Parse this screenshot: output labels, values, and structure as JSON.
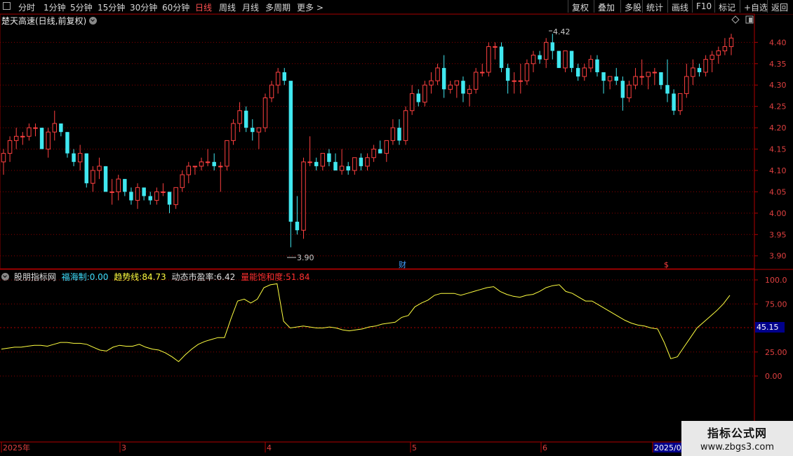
{
  "toolbar": {
    "left_items": [
      "分时",
      "1分钟",
      "5分钟",
      "15分钟",
      "30分钟",
      "60分钟",
      "日线",
      "周线",
      "月线",
      "多周期",
      "更多 >"
    ],
    "active_item": "日线",
    "right_items": [
      "复权",
      "叠加",
      "多股",
      "统计",
      "画线",
      "F10",
      "标记",
      "+自选",
      "返回"
    ]
  },
  "main_pane": {
    "title": "楚天高速(日线,前复权)",
    "price_axis": [
      "4.40",
      "4.35",
      "4.30",
      "4.25",
      "4.20",
      "4.15",
      "4.10",
      "4.05",
      "4.00",
      "3.95",
      "3.90"
    ],
    "high_label": "4.42",
    "low_label": "3.90",
    "event_marker_cai": "财",
    "event_marker_s": "$"
  },
  "indicator_pane": {
    "name": "股朋指标网",
    "items": [
      {
        "label": "福海制:",
        "value": "0.00",
        "color": "#40e0ff"
      },
      {
        "label": "趋势线:",
        "value": "84.73",
        "color": "#ffff40"
      },
      {
        "label": "动态市盈率:",
        "value": "6.42",
        "color": "#e0e0e0"
      },
      {
        "label": "量能饱和度:",
        "value": "51.84",
        "color": "#ff3030"
      }
    ],
    "axis": [
      "100.0",
      "75.00",
      "25.00",
      "0.00"
    ],
    "current_value": "45.15"
  },
  "date_axis": [
    "2025年",
    "3",
    "4",
    "5",
    "6",
    "2025/07"
  ],
  "watermark": {
    "line1": "指标公式网",
    "line2": "www.zbgs3.com"
  },
  "colors": {
    "up": "#ff4040",
    "down": "#40e8f0",
    "line": "#ffff40",
    "grid": "#8b0000"
  },
  "chart_data": {
    "type": "candlestick",
    "y_range": [
      3.87,
      4.44
    ],
    "candles": [
      [
        4.12,
        4.15,
        4.09,
        4.14
      ],
      [
        4.14,
        4.18,
        4.12,
        4.17
      ],
      [
        4.17,
        4.2,
        4.15,
        4.18
      ],
      [
        4.18,
        4.19,
        4.16,
        4.18
      ],
      [
        4.18,
        4.21,
        4.17,
        4.2
      ],
      [
        4.2,
        4.21,
        4.18,
        4.2
      ],
      [
        4.2,
        4.2,
        4.15,
        4.15
      ],
      [
        4.15,
        4.2,
        4.13,
        4.19
      ],
      [
        4.19,
        4.24,
        4.17,
        4.21
      ],
      [
        4.21,
        4.21,
        4.18,
        4.19
      ],
      [
        4.19,
        4.19,
        4.13,
        4.14
      ],
      [
        4.14,
        4.15,
        4.11,
        4.12
      ],
      [
        4.12,
        4.16,
        4.1,
        4.14
      ],
      [
        4.14,
        4.14,
        4.06,
        4.07
      ],
      [
        4.07,
        4.11,
        4.05,
        4.1
      ],
      [
        4.1,
        4.13,
        4.08,
        4.11
      ],
      [
        4.11,
        4.11,
        4.05,
        4.05
      ],
      [
        4.05,
        4.08,
        4.02,
        4.05
      ],
      [
        4.05,
        4.09,
        4.03,
        4.08
      ],
      [
        4.08,
        4.08,
        4.04,
        4.05
      ],
      [
        4.05,
        4.06,
        4.02,
        4.03
      ],
      [
        4.03,
        4.07,
        4.01,
        4.06
      ],
      [
        4.06,
        4.06,
        4.03,
        4.04
      ],
      [
        4.04,
        4.05,
        4.02,
        4.03
      ],
      [
        4.03,
        4.06,
        4.02,
        4.05
      ],
      [
        4.05,
        4.07,
        4.04,
        4.05
      ],
      [
        4.05,
        4.05,
        4.0,
        4.02
      ],
      [
        4.02,
        4.06,
        4.01,
        4.06
      ],
      [
        4.06,
        4.1,
        4.05,
        4.09
      ],
      [
        4.09,
        4.12,
        4.07,
        4.11
      ],
      [
        4.11,
        4.11,
        4.09,
        4.11
      ],
      [
        4.11,
        4.13,
        4.1,
        4.12
      ],
      [
        4.12,
        4.15,
        4.11,
        4.12
      ],
      [
        4.12,
        4.14,
        4.1,
        4.11
      ],
      [
        4.11,
        4.12,
        4.05,
        4.11
      ],
      [
        4.11,
        4.17,
        4.1,
        4.17
      ],
      [
        4.17,
        4.22,
        4.16,
        4.21
      ],
      [
        4.21,
        4.26,
        4.19,
        4.24
      ],
      [
        4.24,
        4.25,
        4.19,
        4.2
      ],
      [
        4.2,
        4.22,
        4.17,
        4.19
      ],
      [
        4.19,
        4.2,
        4.15,
        4.2
      ],
      [
        4.2,
        4.28,
        4.19,
        4.27
      ],
      [
        4.27,
        4.31,
        4.26,
        4.3
      ],
      [
        4.3,
        4.34,
        4.28,
        4.33
      ],
      [
        4.33,
        4.34,
        4.3,
        4.31
      ],
      [
        4.31,
        4.25,
        3.92,
        3.98
      ],
      [
        3.98,
        4.04,
        3.95,
        3.96
      ],
      [
        3.96,
        4.13,
        3.94,
        4.12
      ],
      [
        4.12,
        4.18,
        4.11,
        4.12
      ],
      [
        4.12,
        4.13,
        4.1,
        4.11
      ],
      [
        4.11,
        4.14,
        4.1,
        4.14
      ],
      [
        4.14,
        4.15,
        4.11,
        4.12
      ],
      [
        4.12,
        4.14,
        4.1,
        4.1
      ],
      [
        4.1,
        4.15,
        4.09,
        4.11
      ],
      [
        4.11,
        4.12,
        4.09,
        4.1
      ],
      [
        4.1,
        4.13,
        4.09,
        4.13
      ],
      [
        4.13,
        4.14,
        4.1,
        4.11
      ],
      [
        4.11,
        4.14,
        4.1,
        4.13
      ],
      [
        4.13,
        4.16,
        4.12,
        4.15
      ],
      [
        4.15,
        4.17,
        4.14,
        4.14
      ],
      [
        4.14,
        4.17,
        4.12,
        4.17
      ],
      [
        4.17,
        4.22,
        4.16,
        4.2
      ],
      [
        4.2,
        4.22,
        4.16,
        4.17
      ],
      [
        4.17,
        4.25,
        4.16,
        4.24
      ],
      [
        4.24,
        4.3,
        4.23,
        4.28
      ],
      [
        4.28,
        4.29,
        4.25,
        4.26
      ],
      [
        4.26,
        4.31,
        4.25,
        4.3
      ],
      [
        4.3,
        4.33,
        4.28,
        4.31
      ],
      [
        4.31,
        4.35,
        4.3,
        4.34
      ],
      [
        4.34,
        4.37,
        4.27,
        4.29
      ],
      [
        4.29,
        4.31,
        4.28,
        4.3
      ],
      [
        4.3,
        4.31,
        4.27,
        4.31
      ],
      [
        4.31,
        4.32,
        4.26,
        4.28
      ],
      [
        4.28,
        4.3,
        4.25,
        4.29
      ],
      [
        4.29,
        4.34,
        4.28,
        4.33
      ],
      [
        4.33,
        4.35,
        4.32,
        4.33
      ],
      [
        4.33,
        4.4,
        4.32,
        4.39
      ],
      [
        4.39,
        4.4,
        4.36,
        4.39
      ],
      [
        4.39,
        4.4,
        4.33,
        4.34
      ],
      [
        4.34,
        4.35,
        4.28,
        4.31
      ],
      [
        4.31,
        4.33,
        4.28,
        4.31
      ],
      [
        4.31,
        4.35,
        4.28,
        4.31
      ],
      [
        4.31,
        4.36,
        4.3,
        4.35
      ],
      [
        4.35,
        4.38,
        4.33,
        4.37
      ],
      [
        4.37,
        4.38,
        4.35,
        4.36
      ],
      [
        4.36,
        4.41,
        4.34,
        4.4
      ],
      [
        4.4,
        4.42,
        4.36,
        4.38
      ],
      [
        4.38,
        4.38,
        4.34,
        4.34
      ],
      [
        4.34,
        4.38,
        4.33,
        4.38
      ],
      [
        4.38,
        4.38,
        4.33,
        4.34
      ],
      [
        4.34,
        4.35,
        4.31,
        4.32
      ],
      [
        4.32,
        4.35,
        4.31,
        4.34
      ],
      [
        4.34,
        4.37,
        4.33,
        4.36
      ],
      [
        4.36,
        4.37,
        4.32,
        4.33
      ],
      [
        4.33,
        4.33,
        4.28,
        4.31
      ],
      [
        4.31,
        4.32,
        4.29,
        4.32
      ],
      [
        4.32,
        4.34,
        4.3,
        4.31
      ],
      [
        4.31,
        4.32,
        4.24,
        4.27
      ],
      [
        4.27,
        4.31,
        4.26,
        4.3
      ],
      [
        4.3,
        4.34,
        4.29,
        4.32
      ],
      [
        4.32,
        4.36,
        4.3,
        4.32
      ],
      [
        4.32,
        4.33,
        4.29,
        4.33
      ],
      [
        4.33,
        4.34,
        4.3,
        4.33
      ],
      [
        4.33,
        4.33,
        4.29,
        4.3
      ],
      [
        4.3,
        4.36,
        4.26,
        4.28
      ],
      [
        4.28,
        4.29,
        4.23,
        4.24
      ],
      [
        4.24,
        4.28,
        4.23,
        4.28
      ],
      [
        4.28,
        4.35,
        4.27,
        4.32
      ],
      [
        4.32,
        4.36,
        4.3,
        4.34
      ],
      [
        4.34,
        4.35,
        4.32,
        4.33
      ],
      [
        4.33,
        4.37,
        4.32,
        4.36
      ],
      [
        4.36,
        4.38,
        4.33,
        4.37
      ],
      [
        4.37,
        4.39,
        4.35,
        4.38
      ],
      [
        4.38,
        4.41,
        4.37,
        4.39
      ],
      [
        4.39,
        4.42,
        4.37,
        4.41
      ]
    ],
    "indicator": {
      "name": "趋势线",
      "y_range": [
        -20,
        110
      ],
      "values": [
        28,
        29,
        30,
        30,
        31,
        32,
        32,
        31,
        33,
        35,
        35,
        34,
        34,
        33,
        30,
        27,
        26,
        30,
        32,
        31,
        31,
        33,
        30,
        28,
        27,
        24,
        20,
        15,
        22,
        28,
        33,
        36,
        38,
        40,
        40,
        60,
        78,
        80,
        76,
        80,
        92,
        95,
        96,
        57,
        50,
        51,
        52,
        51,
        50,
        50,
        51,
        50,
        48,
        47,
        48,
        49,
        51,
        52,
        54,
        55,
        56,
        61,
        63,
        72,
        76,
        79,
        84,
        86,
        86,
        86,
        84,
        86,
        88,
        90,
        92,
        93,
        88,
        85,
        83,
        82,
        84,
        85,
        88,
        92,
        94,
        95,
        88,
        86,
        82,
        78,
        78,
        74,
        70,
        66,
        62,
        58,
        55,
        53,
        52,
        50,
        49,
        35,
        18,
        20,
        30,
        40,
        50,
        56,
        62,
        68,
        75,
        84
      ]
    }
  }
}
